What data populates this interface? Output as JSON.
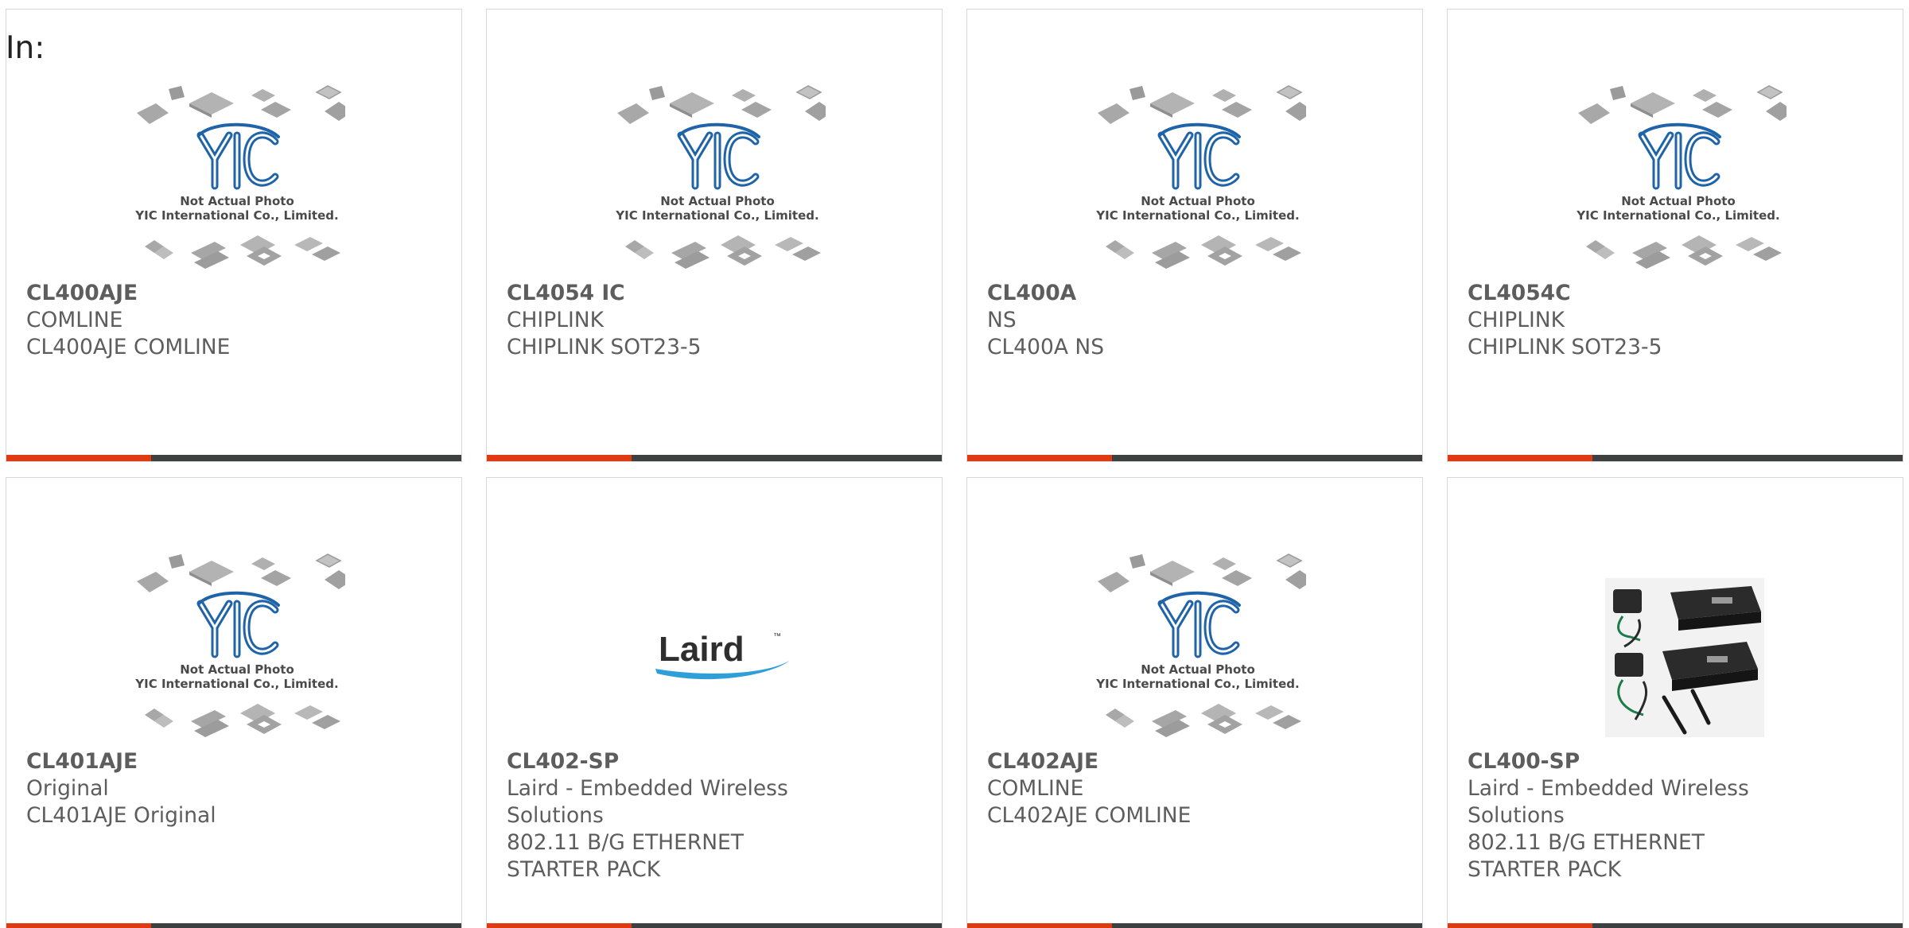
{
  "heading": "In:",
  "accent_color": "#e03a12",
  "bar_color": "#3d4040",
  "image_text": {
    "line1": "Not Actual Photo",
    "line2": "YIC International Co., Limited.",
    "logo": "YIC",
    "laird": "Laird"
  },
  "cards": [
    {
      "part": "CL400AJE",
      "maker": "COMLINE",
      "desc": "CL400AJE COMLINE",
      "image": "yic-placeholder"
    },
    {
      "part": "CL4054 IC",
      "maker": "CHIPLINK",
      "desc": "CHIPLINK SOT23-5",
      "image": "yic-placeholder"
    },
    {
      "part": "CL400A",
      "maker": "NS",
      "desc": "CL400A NS",
      "image": "yic-placeholder"
    },
    {
      "part": "CL4054C",
      "maker": "CHIPLINK",
      "desc": "CHIPLINK SOT23-5",
      "image": "yic-placeholder"
    },
    {
      "part": "CL401AJE",
      "maker": "Original",
      "desc": "CL401AJE Original",
      "image": "yic-placeholder"
    },
    {
      "part": "CL402-SP",
      "maker": "Laird - Embedded Wireless Solutions",
      "desc": "802.11 B/G ETHERNET STARTER PACK",
      "image": "laird-logo"
    },
    {
      "part": "CL402AJE",
      "maker": "COMLINE",
      "desc": "CL402AJE COMLINE",
      "image": "yic-placeholder"
    },
    {
      "part": "CL400-SP",
      "maker": "Laird - Embedded Wireless Solutions",
      "desc": "802.11 B/G ETHERNET STARTER PACK",
      "image": "product-photo"
    }
  ]
}
